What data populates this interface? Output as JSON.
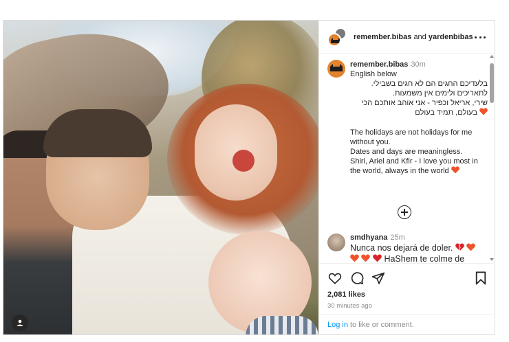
{
  "header": {
    "user1": "remember.bibas",
    "connector": "and",
    "user2": "yardenbibas",
    "more_icon": "more-horizontal-icon"
  },
  "caption": {
    "username": "remember.bibas",
    "time": "30m",
    "lines": [
      "English below",
      "בלעדיכם החגים הם לא חגים בשבילי.",
      "לתאריכים ולימים אין משמעות.",
      "שירי, אריאל וכפיר - אני אוהב אותכם הכי",
      "בעולם, תמיד בעולם",
      "The holidays are not holidays for me without you.",
      "Dates and days are meaningless.",
      "Shiri, Ariel and Kfir - I love you most in the world, always in the world"
    ],
    "heart_color": "#f0532c"
  },
  "load_more_icon": "plus-circle-icon",
  "comment": {
    "username": "smdhyana",
    "time": "25m",
    "text_a": "Nunca nos dejará de doler.",
    "text_b": "HaShem te colme de fuerza, sabiduría y consuelo. Siempre estarán en nuestros",
    "emoji": [
      "broken-heart",
      "orange-heart",
      "orange-heart",
      "orange-heart",
      "red-heart"
    ]
  },
  "actions": {
    "like_icon": "heart-icon",
    "comment_icon": "comment-icon",
    "share_icon": "share-icon",
    "save_icon": "bookmark-icon",
    "likes": "2,081 likes",
    "time_ago": "30 minutes ago"
  },
  "login": {
    "link": "Log in",
    "rest": "to like or comment."
  },
  "photo": {
    "user_tag_icon": "user-tag-icon"
  },
  "colors": {
    "link": "#0095f6",
    "avatar_orange": "#e4832e",
    "heart_orange": "#f0532c",
    "heart_red": "#d8242b"
  }
}
